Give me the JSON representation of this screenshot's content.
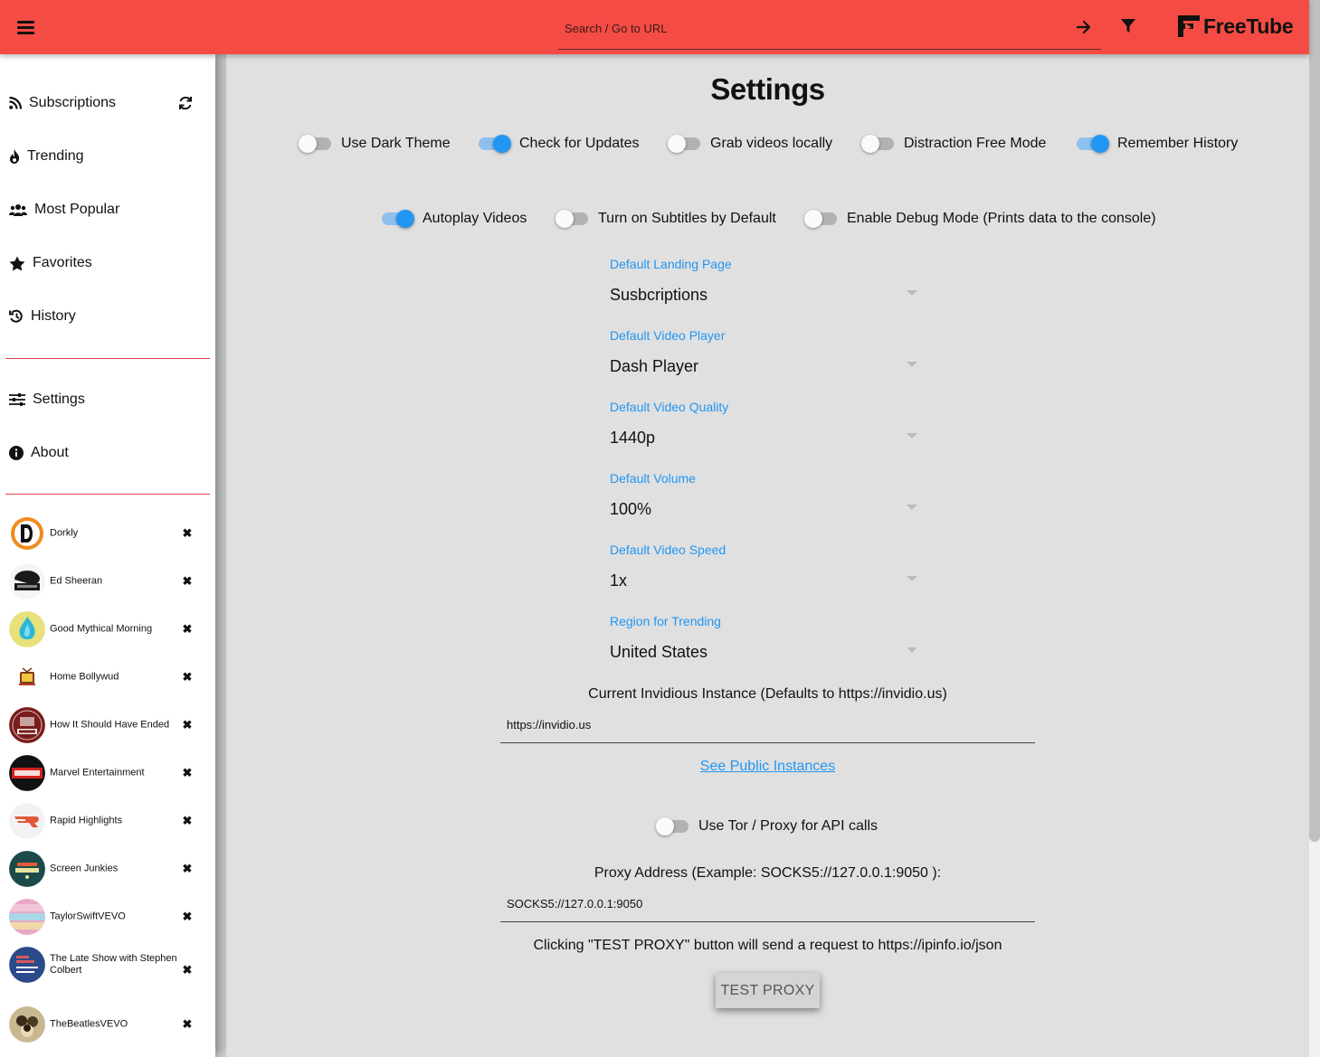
{
  "app": {
    "name": "FreeTube"
  },
  "search": {
    "placeholder": "Search / Go to URL"
  },
  "sidebar": {
    "nav": [
      {
        "label": "Subscriptions",
        "icon": "rss-icon"
      },
      {
        "label": "Trending",
        "icon": "fire-icon"
      },
      {
        "label": "Most Popular",
        "icon": "users-icon"
      },
      {
        "label": "Favorites",
        "icon": "star-icon"
      },
      {
        "label": "History",
        "icon": "history-icon"
      }
    ],
    "secondary": [
      {
        "label": "Settings",
        "icon": "sliders-icon"
      },
      {
        "label": "About",
        "icon": "info-icon"
      }
    ],
    "subscriptions": [
      {
        "name": "Dorkly",
        "color": "#f08c1e"
      },
      {
        "name": "Ed Sheeran",
        "color": "#1a1a1a"
      },
      {
        "name": "Good Mythical Morning",
        "color": "#2ab7d8"
      },
      {
        "name": "Home Bollywud",
        "color": "#7a3e1a"
      },
      {
        "name": "How It Should Have Ended",
        "color": "#7a1c1c"
      },
      {
        "name": "Marvel Entertainment",
        "color": "#d32020"
      },
      {
        "name": "Rapid Highlights",
        "color": "#e05a3a"
      },
      {
        "name": "Screen Junkies",
        "color": "#1c4a4a"
      },
      {
        "name": "TaylorSwiftVEVO",
        "color": "#e8a8c8"
      },
      {
        "name": "The Late Show with Stephen Colbert",
        "color": "#2b4a8a"
      },
      {
        "name": "TheBeatlesVEVO",
        "color": "#6a5a3a"
      }
    ]
  },
  "settings": {
    "title": "Settings",
    "toggles_row1": [
      {
        "label": "Use Dark Theme",
        "on": false
      },
      {
        "label": "Check for Updates",
        "on": true
      },
      {
        "label": "Grab videos locally",
        "on": false
      },
      {
        "label": "Distraction Free Mode",
        "on": false
      },
      {
        "label": "Remember History",
        "on": true
      }
    ],
    "toggles_row2": [
      {
        "label": "Autoplay Videos",
        "on": true
      },
      {
        "label": "Turn on Subtitles by Default",
        "on": false
      },
      {
        "label": "Enable Debug Mode (Prints data to the console)",
        "on": false
      }
    ],
    "selects": [
      {
        "label": "Default Landing Page",
        "value": "Susbcriptions"
      },
      {
        "label": "Default Video Player",
        "value": "Dash Player"
      },
      {
        "label": "Default Video Quality",
        "value": "1440p"
      },
      {
        "label": "Default Volume",
        "value": "100%"
      },
      {
        "label": "Default Video Speed",
        "value": "1x"
      },
      {
        "label": "Region for Trending",
        "value": "United States"
      }
    ],
    "invidious_label": "Current Invidious Instance (Defaults to https://invidio.us)",
    "invidious_value": "https://invidio.us",
    "public_instances_link": "See Public Instances",
    "proxy_toggle": {
      "label": "Use Tor / Proxy for API calls",
      "on": false
    },
    "proxy_label": "Proxy Address (Example: SOCKS5://127.0.0.1:9050 ):",
    "proxy_value": "SOCKS5://127.0.0.1:9050",
    "test_note": "Clicking \"TEST PROXY\" button will send a request to https://ipinfo.io/json",
    "test_button": "TEST PROXY"
  },
  "colors": {
    "accent": "#f44c44",
    "toggle_on": "#2196f3",
    "link": "#2196f3"
  }
}
